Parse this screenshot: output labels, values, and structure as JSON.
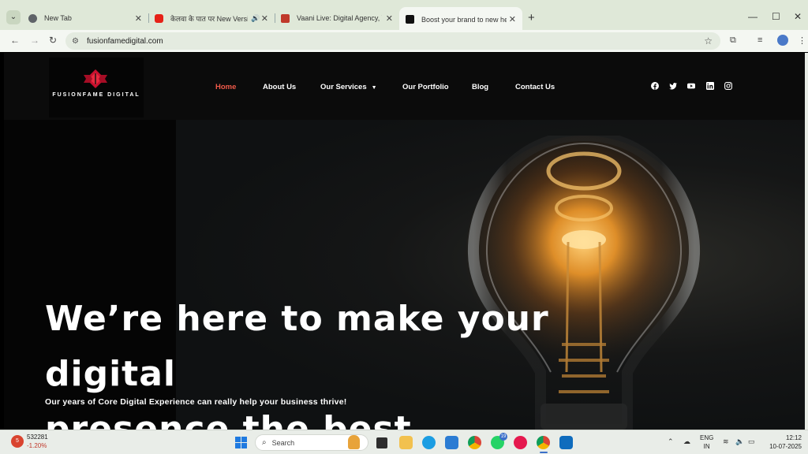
{
  "browser": {
    "tabs": [
      {
        "title": "New Tab",
        "favicon_color": "#5f6368",
        "active": false
      },
      {
        "title": "केलवा के पात पर New Version",
        "favicon_color": "#e62117",
        "active": false
      },
      {
        "title": "Vaani Live: Digital Agency, Web",
        "favicon_color": "#c0392b",
        "active": false
      },
      {
        "title": "Boost your brand to new heigh",
        "favicon_color": "#111111",
        "active": true
      }
    ],
    "new_tab_label": "+",
    "url": "fusionfamedigital.com"
  },
  "site": {
    "logo_text": "FUSIONFAME DIGITAL",
    "nav": [
      {
        "label": "Home",
        "active": true
      },
      {
        "label": "About Us",
        "active": false
      },
      {
        "label": "Our Services",
        "active": false,
        "dropdown": true
      },
      {
        "label": "Our Portfolio",
        "active": false
      },
      {
        "label": "Blog",
        "active": false
      },
      {
        "label": "Contact Us",
        "active": false
      }
    ],
    "social": [
      "facebook-icon",
      "twitter-icon",
      "youtube-icon",
      "linkedin-icon",
      "instagram-icon"
    ],
    "hero": {
      "headline_line1": "We’re here to make your digital",
      "headline_line2": "presence the best",
      "subline": "Our years of Core Digital Experience can really help your business thrive!"
    },
    "accent_color": "#f05a4a"
  },
  "taskbar": {
    "stock_badge": "5",
    "stock_value": "532281",
    "stock_change": "-1.20%",
    "search_placeholder": "Search",
    "whatsapp_badge": "19",
    "language_line1": "ENG",
    "language_line2": "IN",
    "time": "12:12",
    "date": "10-07-2025"
  }
}
